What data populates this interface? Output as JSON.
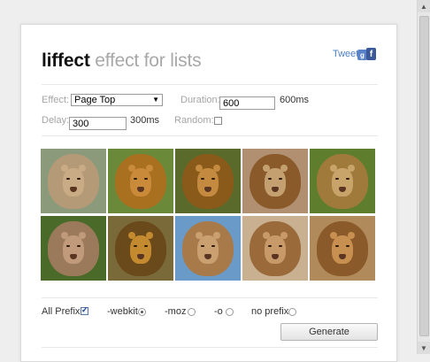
{
  "header": {
    "title_bold": "liffect",
    "title_light": "effect for lists",
    "tweet_label": "Tweet",
    "social_icons": [
      "google-plus-icon",
      "facebook-icon"
    ],
    "social_glyphs": [
      "g",
      "f"
    ]
  },
  "controls": {
    "effect_label": "Effect:",
    "effect_value": "Page Top",
    "duration_label": "Duration:",
    "duration_value": "600",
    "duration_display": "600ms",
    "delay_label": "Delay:",
    "delay_value": "300",
    "delay_display": "300ms",
    "random_label": "Random:",
    "random_checked": false
  },
  "gallery": {
    "images": [
      {
        "name": "lion-photo-1",
        "bg": "#8a9a7a",
        "mane": "#b59a78",
        "face": "#c9ac86"
      },
      {
        "name": "lion-photo-2",
        "bg": "#6a8a3a",
        "mane": "#a8701f",
        "face": "#c98a3a"
      },
      {
        "name": "lion-photo-3",
        "bg": "#5a6a2a",
        "mane": "#8a5a1a",
        "face": "#c48a40"
      },
      {
        "name": "lion-photo-4",
        "bg": "#b09070",
        "mane": "#8a5a2a",
        "face": "#c4a070"
      },
      {
        "name": "lion-photo-5",
        "bg": "#5e7e2e",
        "mane": "#a07a3a",
        "face": "#c8a46a"
      },
      {
        "name": "lion-photo-6",
        "bg": "#4a6a2a",
        "mane": "#9a7a5a",
        "face": "#c09a7a"
      },
      {
        "name": "lion-photo-7",
        "bg": "#7a6a3a",
        "mane": "#6a4a1a",
        "face": "#c48a30"
      },
      {
        "name": "lion-photo-8",
        "bg": "#6a9ac8",
        "mane": "#a87a4a",
        "face": "#caa070"
      },
      {
        "name": "lion-photo-9",
        "bg": "#c8b090",
        "mane": "#9a6a3a",
        "face": "#c89a6a"
      },
      {
        "name": "lion-photo-10",
        "bg": "#b08a5a",
        "mane": "#8a5a2a",
        "face": "#c89050"
      }
    ]
  },
  "prefix": {
    "all_prefix_label": "All Prefix",
    "all_prefix_checked": true,
    "options": [
      {
        "label": "-webkit",
        "selected": true
      },
      {
        "label": "-moz",
        "selected": false
      },
      {
        "label": "-o",
        "selected": false
      },
      {
        "label": "no prefix",
        "selected": false
      }
    ]
  },
  "actions": {
    "generate_label": "Generate"
  }
}
